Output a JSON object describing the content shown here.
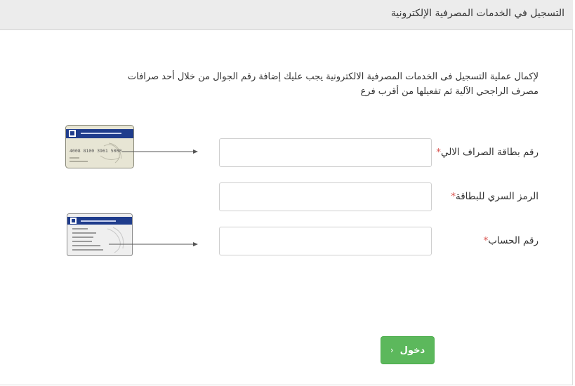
{
  "header": {
    "title": "التسجيل في الخدمات المصرفية الإلكترونية"
  },
  "instructions": {
    "line1": "لإكمال عملية التسجيل فى الخدمات المصرفية الالكترونية يجب عليك إضافة رقم الجوال من خلال أحد صرافات",
    "line2": "مصرف الراجحي الآلية ثم تفعيلها من أقرب فرع"
  },
  "form": {
    "card_number": {
      "label": "رقم بطاقة الصراف الالي",
      "required_mark": "*",
      "value": ""
    },
    "pin": {
      "label": "الرمز السري للبطاقة",
      "required_mark": "*",
      "value": ""
    },
    "account_number": {
      "label": "رقم الحساب",
      "required_mark": "*",
      "value": ""
    }
  },
  "cards": {
    "front_number": "4008 8100 3961 5000"
  },
  "actions": {
    "submit_label": "دخول",
    "submit_icon": "chevron-icon"
  },
  "colors": {
    "accent": "#5cb85c",
    "required": "#d9534f",
    "header_bg": "#ececec",
    "card_stripe": "#1f3c8c"
  }
}
